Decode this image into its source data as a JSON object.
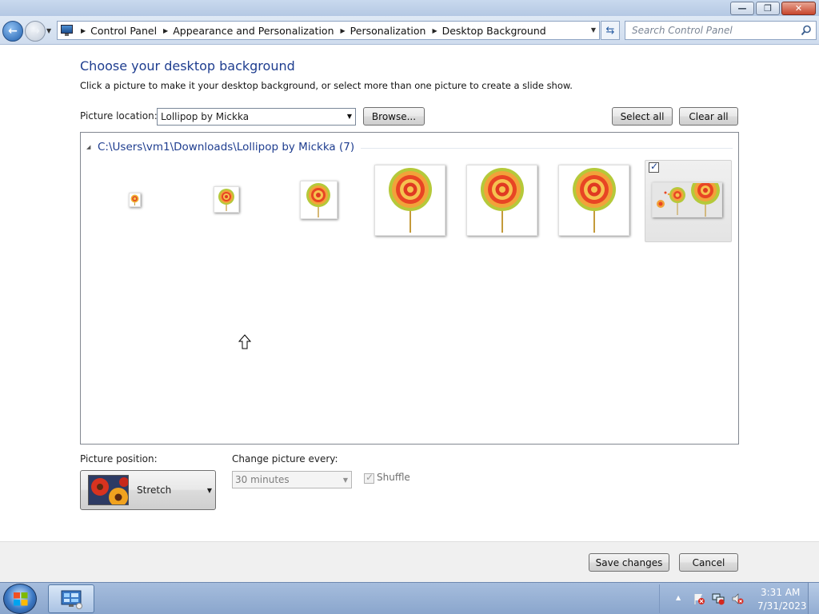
{
  "window": {
    "buttons": {
      "minimize": "—",
      "restore": "❐",
      "close": "✕"
    }
  },
  "nav": {
    "breadcrumb": [
      "Control Panel",
      "Appearance and Personalization",
      "Personalization",
      "Desktop Background"
    ],
    "search_placeholder": "Search Control Panel"
  },
  "page": {
    "title": "Choose your desktop background",
    "description": "Click a picture to make it your desktop background, or select more than one picture to create a slide show.",
    "location_label": "Picture location:",
    "location_value": "Lollipop by Mickka",
    "browse_label": "Browse...",
    "select_all_label": "Select all",
    "clear_all_label": "Clear all"
  },
  "gallery": {
    "folder_path": "C:\\Users\\vm1\\Downloads\\Lollipop by Mickka (7)",
    "pictures": [
      {
        "name": "lollipop-tiny",
        "selected": false
      },
      {
        "name": "lollipop-small",
        "selected": false
      },
      {
        "name": "lollipop-medium",
        "selected": false
      },
      {
        "name": "lollipop-large-1",
        "selected": false
      },
      {
        "name": "lollipop-large-2",
        "selected": false
      },
      {
        "name": "lollipop-large-3",
        "selected": false
      },
      {
        "name": "lollipop-group",
        "selected": true
      }
    ]
  },
  "options": {
    "position_label": "Picture position:",
    "position_value": "Stretch",
    "change_label": "Change picture every:",
    "change_value": "30 minutes",
    "shuffle_label": "Shuffle",
    "shuffle_checked": true
  },
  "footer": {
    "save_label": "Save changes",
    "cancel_label": "Cancel"
  },
  "taskbar": {
    "time": "3:31 AM",
    "date": "7/31/2023"
  },
  "colors": {
    "title_blue": "#1e3d8f",
    "taskbar": "#8aa6cd"
  }
}
